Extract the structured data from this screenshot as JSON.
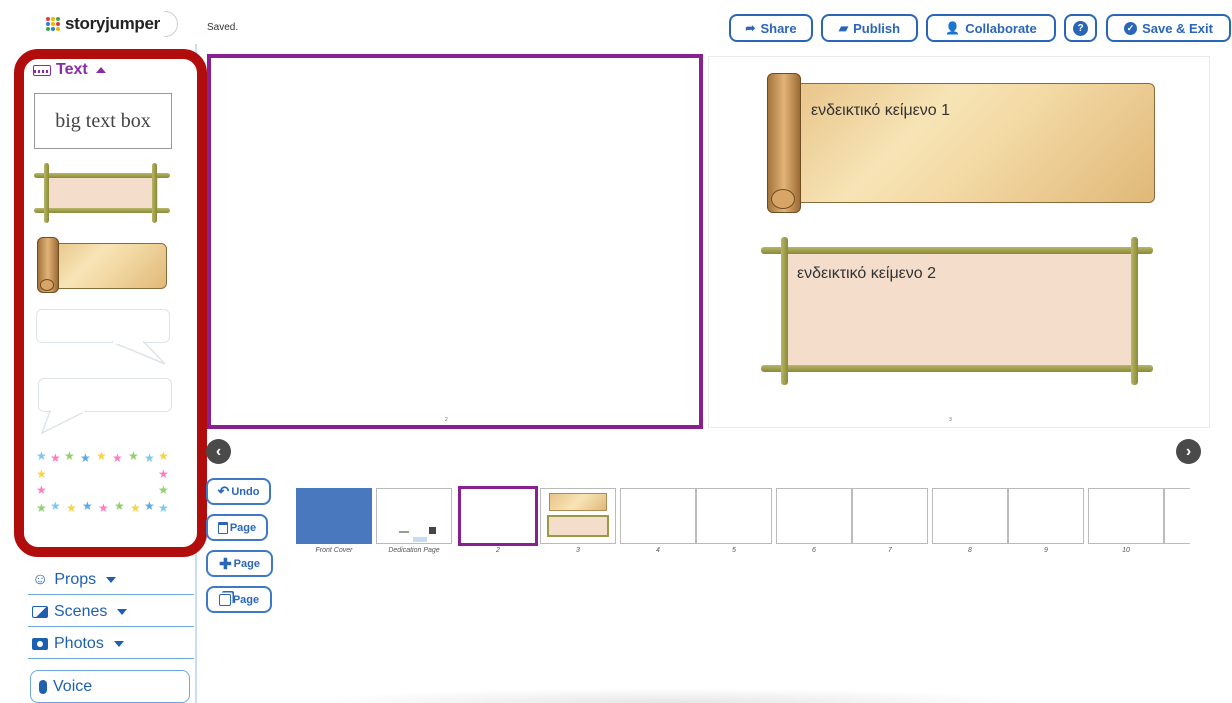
{
  "app": {
    "logo_text": "storyjumper",
    "status": "Saved."
  },
  "toolbar": {
    "share_label": "Share",
    "publish_label": "Publish",
    "collaborate_label": "Collaborate",
    "help_label": "?",
    "save_exit_label": "Save & Exit"
  },
  "panel": {
    "title": "Text",
    "big_text_box": "big text box"
  },
  "side_menu": {
    "props": "Props",
    "scenes": "Scenes",
    "photos": "Photos",
    "voice": "Voice"
  },
  "book": {
    "left_page_number": "2",
    "right_page_number": "3",
    "text_box_1": "ενδεικτικό κείμενο 1",
    "text_box_2": "ενδεικτικό κείμενο 2"
  },
  "page_actions": {
    "undo": "Undo",
    "delete_page": "Page",
    "add_page": "Page",
    "copy_page": "Page"
  },
  "thumbnails": [
    {
      "label": "Front Cover"
    },
    {
      "label": "Dedication Page"
    },
    {
      "label": "2"
    },
    {
      "label": "3"
    },
    {
      "label": "4"
    },
    {
      "label": "5"
    },
    {
      "label": "6"
    },
    {
      "label": "7"
    },
    {
      "label": "8"
    },
    {
      "label": "9"
    },
    {
      "label": "10"
    }
  ],
  "colors": {
    "accent_blue": "#2a66b8",
    "panel_purple": "#8a2ca3",
    "highlight_red": "#b20d0d",
    "selected_page": "#8a1f8f",
    "cover_blue": "#4a78bf"
  },
  "icons": {
    "share": "share-arrow-icon",
    "publish": "book-icon",
    "collaborate": "add-user-icon",
    "help": "question-icon",
    "save": "check-circle-icon",
    "prev": "chevron-left-icon",
    "next": "chevron-right-icon"
  }
}
